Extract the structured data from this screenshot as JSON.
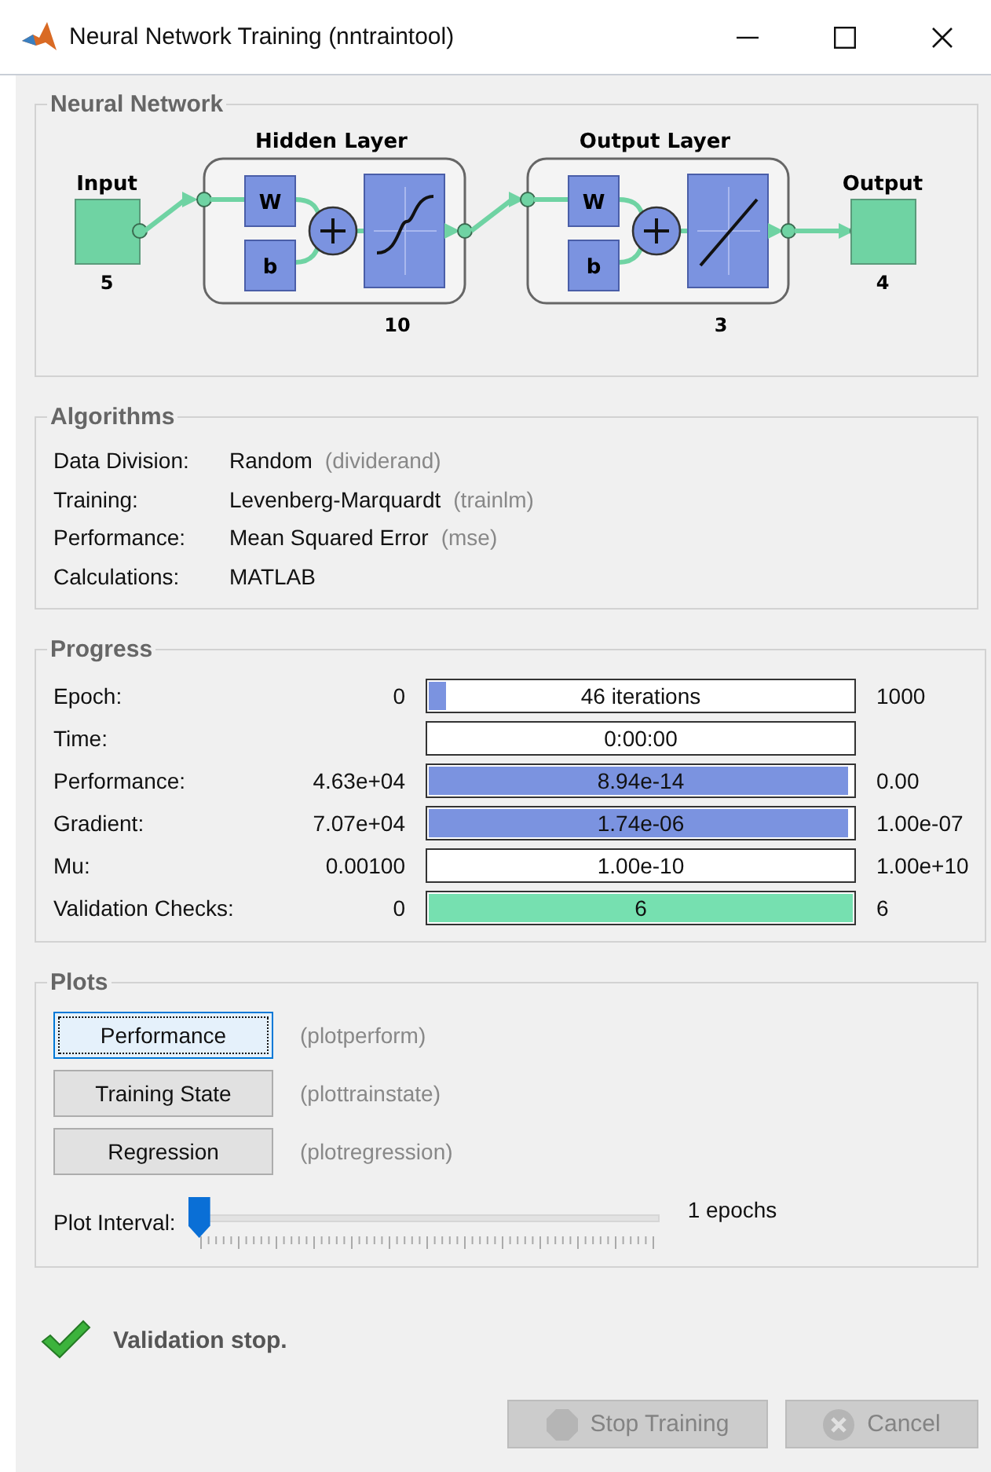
{
  "window": {
    "title": "Neural Network Training (nntraintool)",
    "controls": [
      {
        "kind": "minimize"
      },
      {
        "kind": "maximize"
      },
      {
        "kind": "close"
      }
    ]
  },
  "network": {
    "title": "Neural Network",
    "input": {
      "label": "Input",
      "size": "5"
    },
    "layers": [
      {
        "title": "Hidden Layer",
        "size": "10",
        "weight_label": "W",
        "bias_label": "b",
        "kind": "sigmoid"
      },
      {
        "title": "Output Layer",
        "size": "3",
        "weight_label": "W",
        "bias_label": "b",
        "kind": "linear"
      }
    ],
    "output": {
      "label": "Output",
      "size": "4"
    }
  },
  "algorithms": {
    "title": "Algorithms",
    "rows": [
      {
        "label": "Data Division:",
        "value": "Random",
        "hint": "(dividerand)"
      },
      {
        "label": "Training:",
        "value": "Levenberg-Marquardt",
        "hint": "(trainlm)"
      },
      {
        "label": "Performance:",
        "value": "Mean Squared Error",
        "hint": "(mse)"
      },
      {
        "label": "Calculations:",
        "value": "MATLAB"
      }
    ]
  },
  "progress": {
    "title": "Progress",
    "rows": [
      {
        "label": "Epoch:",
        "start": "0",
        "reading": "46 iterations",
        "level": 0.046,
        "end": "1000",
        "color": "#7b93e0"
      },
      {
        "label": "Time:",
        "reading": "0:00:00"
      },
      {
        "label": "Performance:",
        "start": "4.63e+04",
        "reading": "8.94e-14",
        "level": 0.99,
        "end": "0.00",
        "color": "#7b93e0"
      },
      {
        "label": "Gradient:",
        "start": "7.07e+04",
        "reading": "1.74e-06",
        "level": 0.99,
        "end": "1.00e-07",
        "color": "#7b93e0"
      },
      {
        "label": "Mu:",
        "start": "0.00100",
        "reading": "1.00e-10",
        "end": "1.00e+10"
      },
      {
        "label": "Validation Checks:",
        "start": "0",
        "reading": "6",
        "level": 1,
        "end": "6",
        "color": "#76e0b0"
      }
    ]
  },
  "plots": {
    "title": "Plots",
    "buttons": [
      {
        "label": "Performance",
        "hint": "(plotperform)",
        "focused": true
      },
      {
        "label": "Training State",
        "hint": "(plottrainstate)",
        "focused": false
      },
      {
        "label": "Regression",
        "hint": "(plotregression)",
        "focused": false
      }
    ],
    "interval": {
      "label": "Plot Interval:",
      "level": 0,
      "reading": "1 epochs"
    }
  },
  "status": {
    "text": "Validation stop."
  },
  "footer": [
    {
      "kind": "stop",
      "label": "Stop Training",
      "disabled": true
    },
    {
      "kind": "cancel",
      "label": "Cancel",
      "disabled": true
    }
  ]
}
